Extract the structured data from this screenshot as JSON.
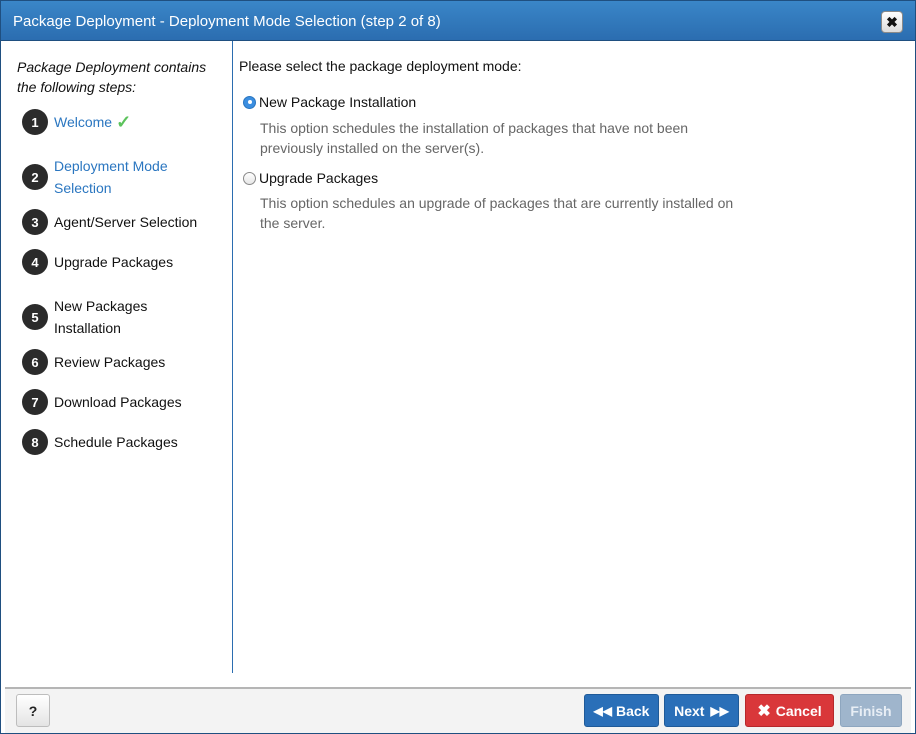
{
  "dialog": {
    "title": "Package Deployment - Deployment Mode Selection (step 2 of 8)",
    "close_label": "✖"
  },
  "sidebar": {
    "intro": "Package Deployment contains the following steps:",
    "steps": [
      {
        "number": "1",
        "label": "Welcome",
        "status": "complete"
      },
      {
        "number": "2",
        "label": "Deployment Mode Selection",
        "status": "current"
      },
      {
        "number": "3",
        "label": "Agent/Server Selection",
        "status": "pending"
      },
      {
        "number": "4",
        "label": "Upgrade Packages",
        "status": "pending"
      },
      {
        "number": "5",
        "label": "New Packages Installation",
        "status": "pending"
      },
      {
        "number": "6",
        "label": "Review Packages",
        "status": "pending"
      },
      {
        "number": "7",
        "label": "Download Packages",
        "status": "pending"
      },
      {
        "number": "8",
        "label": "Schedule Packages",
        "status": "pending"
      }
    ],
    "check_icon": "✓"
  },
  "main": {
    "prompt": "Please select the package deployment mode:",
    "options": [
      {
        "label": "New Package Installation",
        "selected": true,
        "description": "This option schedules the installation of packages that have not been previously installed on the server(s)."
      },
      {
        "label": "Upgrade Packages",
        "selected": false,
        "description": "This option schedules an upgrade of packages that are currently installed on the server."
      }
    ]
  },
  "footer": {
    "help_label": "?",
    "back_label": "Back",
    "next_label": "Next",
    "cancel_label": "Cancel",
    "finish_label": "Finish",
    "finish_enabled": false
  },
  "colors": {
    "titlebar": "#2b6db0",
    "link": "#2a76c0",
    "primary_button": "#2a6fb8",
    "cancel_button": "#d9373a",
    "disabled_button": "#9fb5cc",
    "check": "#5cc35c"
  }
}
